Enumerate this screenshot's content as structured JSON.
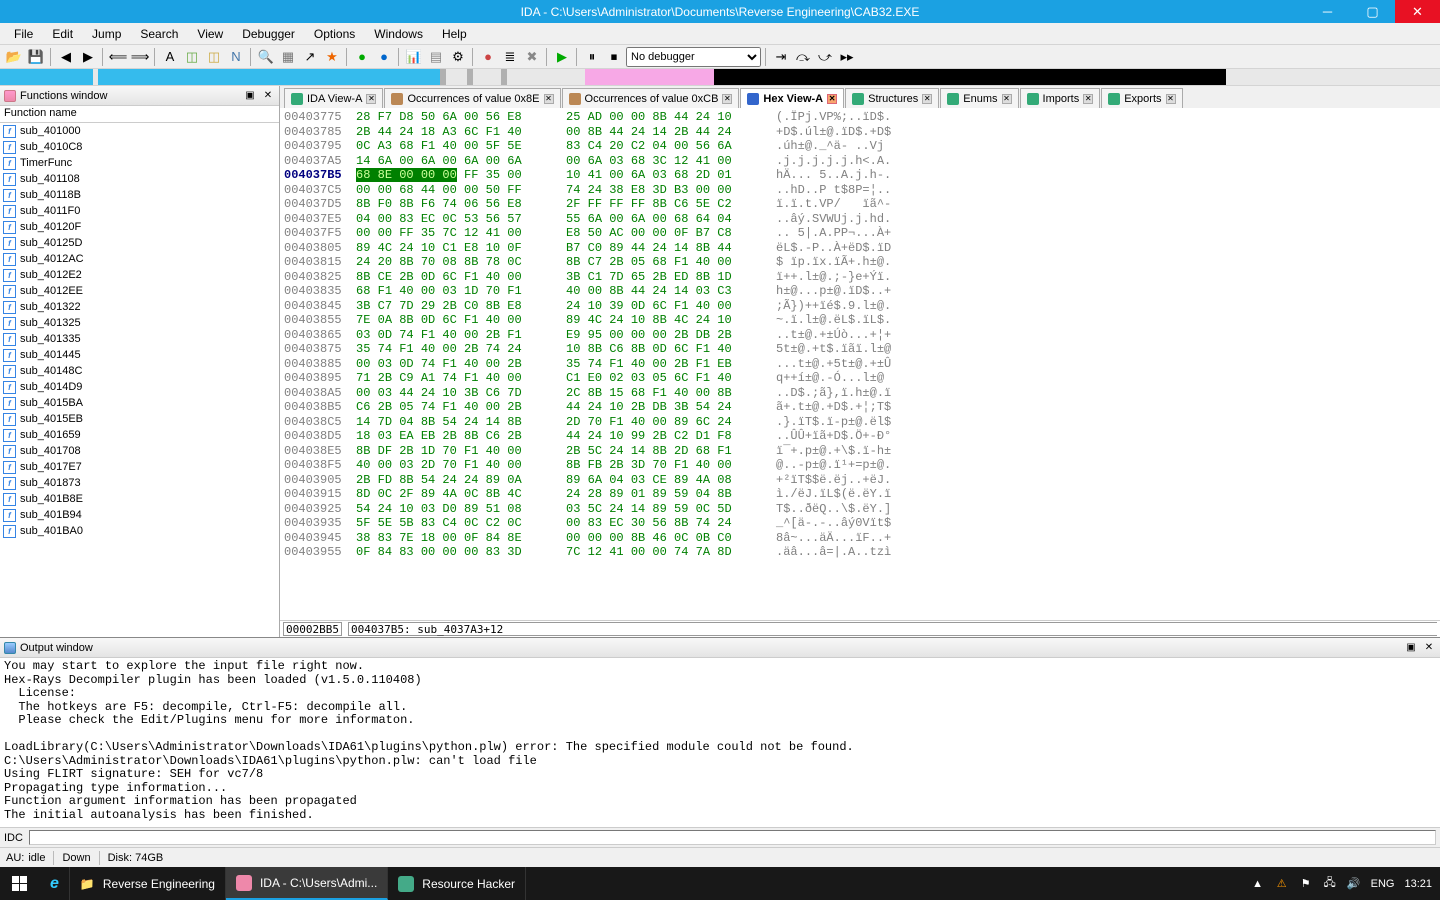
{
  "window": {
    "title": "IDA - C:\\Users\\Administrator\\Documents\\Reverse Engineering\\CAB32.EXE"
  },
  "menu": [
    "File",
    "Edit",
    "Jump",
    "Search",
    "View",
    "Debugger",
    "Options",
    "Windows",
    "Help"
  ],
  "toolbar": {
    "debugger_selected": "No debugger"
  },
  "nav_segments": [
    {
      "color": "#35bbed",
      "width": "6.5%"
    },
    {
      "color": "#e8e8e8",
      "width": "0.4%"
    },
    {
      "color": "#35bbed",
      "width": "24%"
    },
    {
      "color": "#b0b0b0",
      "width": "0.4%"
    },
    {
      "color": "#e8e8e8",
      "width": "1.5%"
    },
    {
      "color": "#b0b0b0",
      "width": "0.4%"
    },
    {
      "color": "#e8e8e8",
      "width": "2%"
    },
    {
      "color": "#b0b0b0",
      "width": "0.4%"
    },
    {
      "color": "#e8e8e8",
      "width": "5.5%"
    },
    {
      "color": "#f7a8e6",
      "width": "9%"
    },
    {
      "color": "#000000",
      "width": "36%"
    },
    {
      "color": "#e8e8e8",
      "width": "15%"
    }
  ],
  "functions": {
    "title": "Functions window",
    "col_header": "Function name",
    "items": [
      "sub_401000",
      "sub_4010C8",
      "TimerFunc",
      "sub_401108",
      "sub_40118B",
      "sub_4011F0",
      "sub_40120F",
      "sub_40125D",
      "sub_4012AC",
      "sub_4012E2",
      "sub_4012EE",
      "sub_401322",
      "sub_401325",
      "sub_401335",
      "sub_401445",
      "sub_40148C",
      "sub_4014D9",
      "sub_4015BA",
      "sub_4015EB",
      "sub_401659",
      "sub_401708",
      "sub_4017E7",
      "sub_401873",
      "sub_401B8E",
      "sub_401B94",
      "sub_401BA0"
    ]
  },
  "tabs": [
    {
      "label": "IDA View-A",
      "icon": "ida",
      "close": "grey"
    },
    {
      "label": "Occurrences of value 0x8E",
      "icon": "head",
      "close": "grey"
    },
    {
      "label": "Occurrences of value 0xCB",
      "icon": "head",
      "close": "grey"
    },
    {
      "label": "Hex View-A",
      "icon": "hex",
      "active": true,
      "close": "orange"
    },
    {
      "label": "Structures",
      "icon": "struct",
      "close": "grey"
    },
    {
      "label": "Enums",
      "icon": "enum",
      "close": "grey"
    },
    {
      "label": "Imports",
      "icon": "imp",
      "close": "grey"
    },
    {
      "label": "Exports",
      "icon": "exp",
      "close": "grey"
    }
  ],
  "hex": {
    "status_left": "00002BB5",
    "status_right": "004037B5: sub_4037A3+12",
    "rows": [
      {
        "addr": "00403775",
        "b1": "28 F7 D8 50 6A 00 56 E8",
        "b2": "25 AD 00 00 8B 44 24 10",
        "asc": "(.ÏPj.VP%;..ïD$."
      },
      {
        "addr": "00403785",
        "b1": "2B 44 24 18 A3 6C F1 40",
        "b2": "00 8B 44 24 14 2B 44 24",
        "asc": "+D$.úl±@.ïD$.+D$"
      },
      {
        "addr": "00403795",
        "b1": "0C A3 68 F1 40 00 5F 5E",
        "b2": "83 C4 20 C2 04 00 56 6A",
        "asc": ".úh±@._^ä- ..Vj"
      },
      {
        "addr": "004037A5",
        "b1": "14 6A 00 6A 00 6A 00 6A",
        "b2": "00 6A 03 68 3C 12 41 00",
        "asc": ".j.j.j.j.j.h<.A."
      },
      {
        "addr": "004037B5",
        "b1": "68 8E 00 00 00",
        "b1_hl": true,
        "b1_rest": " FF 35 00",
        "b2": "10 41 00 6A 03 68 2D 01",
        "asc": "hÄ... 5..A.j.h-."
      },
      {
        "addr": "004037C5",
        "b1": "00 00 68 44 00 00 50 FF",
        "b2": "74 24 38 E8 3D B3 00 00",
        "asc": "..hD..P t$8P=¦.."
      },
      {
        "addr": "004037D5",
        "b1": "8B F0 8B F6 74 06 56 E8",
        "b2": "2F FF FF FF 8B C6 5E C2",
        "asc": "ï.ï.t.VP/   ïã^-"
      },
      {
        "addr": "004037E5",
        "b1": "04 00 83 EC 0C 53 56 57",
        "b2": "55 6A 00 6A 00 68 64 04",
        "asc": "..âý.SVWUj.j.hd."
      },
      {
        "addr": "004037F5",
        "b1": "00 00 FF 35 7C 12 41 00",
        "b2": "E8 50 AC 00 00 0F B7 C8",
        "asc": ".. 5|.A.PP¬...À+"
      },
      {
        "addr": "00403805",
        "b1": "89 4C 24 10 C1 E8 10 0F",
        "b2": "B7 C0 89 44 24 14 8B 44",
        "asc": "ëL$.-P..À+ëD$.ïD"
      },
      {
        "addr": "00403815",
        "b1": "24 20 8B 70 08 8B 78 0C",
        "b2": "8B C7 2B 05 68 F1 40 00",
        "asc": "$ ïp.ïx.ïÃ+.h±@."
      },
      {
        "addr": "00403825",
        "b1": "8B CE 2B 0D 6C F1 40 00",
        "b2": "3B C1 7D 65 2B ED 8B 1D",
        "asc": "ï++.l±@.;-}e+Ýï."
      },
      {
        "addr": "00403835",
        "b1": "68 F1 40 00 03 1D 70 F1",
        "b2": "40 00 8B 44 24 14 03 C3",
        "asc": "h±@...p±@.ïD$..+"
      },
      {
        "addr": "00403845",
        "b1": "3B C7 7D 29 2B C0 8B E8",
        "b2": "24 10 39 0D 6C F1 40 00",
        "asc": ";Ã})++ïé$.9.l±@."
      },
      {
        "addr": "00403855",
        "b1": "7E 0A 8B 0D 6C F1 40 00",
        "b2": "89 4C 24 10 8B 4C 24 10",
        "asc": "~.ï.l±@.ëL$.ïL$."
      },
      {
        "addr": "00403865",
        "b1": "03 0D 74 F1 40 00 2B F1",
        "b2": "E9 95 00 00 00 2B DB 2B",
        "asc": "..t±@.+±Úò...+¦+"
      },
      {
        "addr": "00403875",
        "b1": "35 74 F1 40 00 2B 74 24",
        "b2": "10 8B C6 8B 0D 6C F1 40",
        "asc": "5t±@.+t$.ïãï.l±@"
      },
      {
        "addr": "00403885",
        "b1": "00 03 0D 74 F1 40 00 2B",
        "b2": "35 74 F1 40 00 2B F1 EB",
        "b_ln": true,
        "asc": "...t±@.+5t±@.+±Û"
      },
      {
        "addr": "00403895",
        "b1": "71 2B C9 A1 74 F1 40 00",
        "b2": "C1 E0 02 03 05 6C F1 40",
        "asc": "q++í±@.-Ó...l±@"
      },
      {
        "addr": "004038A5",
        "b1": "00 03 44 24 10 3B C6 7D",
        "b2": "2C 8B 15 68 F1 40 00 8B",
        "asc": "..D$.;ã},ï.h±@.ï"
      },
      {
        "addr": "004038B5",
        "b1": "C6 2B 05 74 F1 40 00 2B",
        "b2": "44 24 10 2B DB 3B 54 24",
        "asc": "ã+.t±@.+D$.+¦;T$"
      },
      {
        "addr": "004038C5",
        "b1": "14 7D 04 8B 54 24 14 8B",
        "b2": "2D 70 F1 40 00 89 6C 24",
        "asc": ".}.ïT$.ï-p±@.ël$"
      },
      {
        "addr": "004038D5",
        "b1": "18 03 EA EB 2B 8B C6 2B",
        "b2": "44 24 10 99 2B C2 D1 F8",
        "asc": "..ÛÛ+ïã+D$.Ö+-Ð°"
      },
      {
        "addr": "004038E5",
        "b1": "8B DF 2B 1D 70 F1 40 00",
        "b2": "2B 5C 24 14 8B 2D 68 F1",
        "asc": "ï¯+.p±@.+\\$.ï-h±"
      },
      {
        "addr": "004038F5",
        "b1": "40 00 03 2D 70 F1 40 00",
        "b2": "8B FB 2B 3D 70 F1 40 00",
        "asc": "@..-p±@.ï¹+=p±@."
      },
      {
        "addr": "00403905",
        "b1": "2B FD 8B 54 24 24 89 0A",
        "b2": "89 6A 04 03 CE 89 4A 08",
        "asc": "+²ïT$$ë.ëj..+ëJ."
      },
      {
        "addr": "00403915",
        "b1": "8D 0C 2F 89 4A 0C 8B 4C",
        "b2": "24 28 89 01 89 59 04 8B",
        "asc": "ì./ëJ.ïL$(ë.ëY.ï"
      },
      {
        "addr": "00403925",
        "b1": "54 24 10 03 D0 89 51 08",
        "b2": "03 5C 24 14 89 59 0C 5D",
        "asc": "T$..ðëQ..\\$.ëY.]"
      },
      {
        "addr": "00403935",
        "b1": "5F 5E 5B 83 C4 0C C2 0C",
        "b2": "00 83 EC 30 56 8B 74 24",
        "asc": "_^[ä-.-..âý0Vït$"
      },
      {
        "addr": "00403945",
        "b1": "38 83 7E 18 00 0F 84 8E",
        "b2": "00 00 00 8B 46 0C 0B C0",
        "asc": "8â~...äÄ...ïF..+"
      },
      {
        "addr": "00403955",
        "b1": "0F 84 83 00 00 00 83 3D",
        "b2": "7C 12 41 00 00 74 7A 8D",
        "asc": ".äâ...â=|.A..tzì"
      }
    ]
  },
  "output": {
    "title": "Output window",
    "lines": [
      "You may start to explore the input file right now.",
      "Hex-Rays Decompiler plugin has been loaded (v1.5.0.110408)",
      "  License:",
      "  The hotkeys are F5: decompile, Ctrl-F5: decompile all.",
      "  Please check the Edit/Plugins menu for more informaton.",
      "",
      "LoadLibrary(C:\\Users\\Administrator\\Downloads\\IDA61\\plugins\\python.plw) error: The specified module could not be found.",
      "C:\\Users\\Administrator\\Downloads\\IDA61\\plugins\\python.plw: can't load file",
      "Using FLIRT signature: SEH for vc7/8",
      "Propagating type information...",
      "Function argument information has been propagated",
      "The initial autoanalysis has been finished."
    ]
  },
  "idc_label": "IDC",
  "status": {
    "au": "AU:",
    "idle": "idle",
    "down": "Down",
    "disk": "Disk: 74GB"
  },
  "taskbar": {
    "items": [
      {
        "label": "",
        "icon": "ie"
      },
      {
        "label": "Reverse Engineering",
        "icon": "folder"
      },
      {
        "label": "IDA - C:\\Users\\Admi...",
        "icon": "ida",
        "active": true
      },
      {
        "label": "Resource Hacker",
        "icon": "rh"
      }
    ],
    "tray": {
      "lang": "ENG",
      "time": "13:21"
    }
  }
}
